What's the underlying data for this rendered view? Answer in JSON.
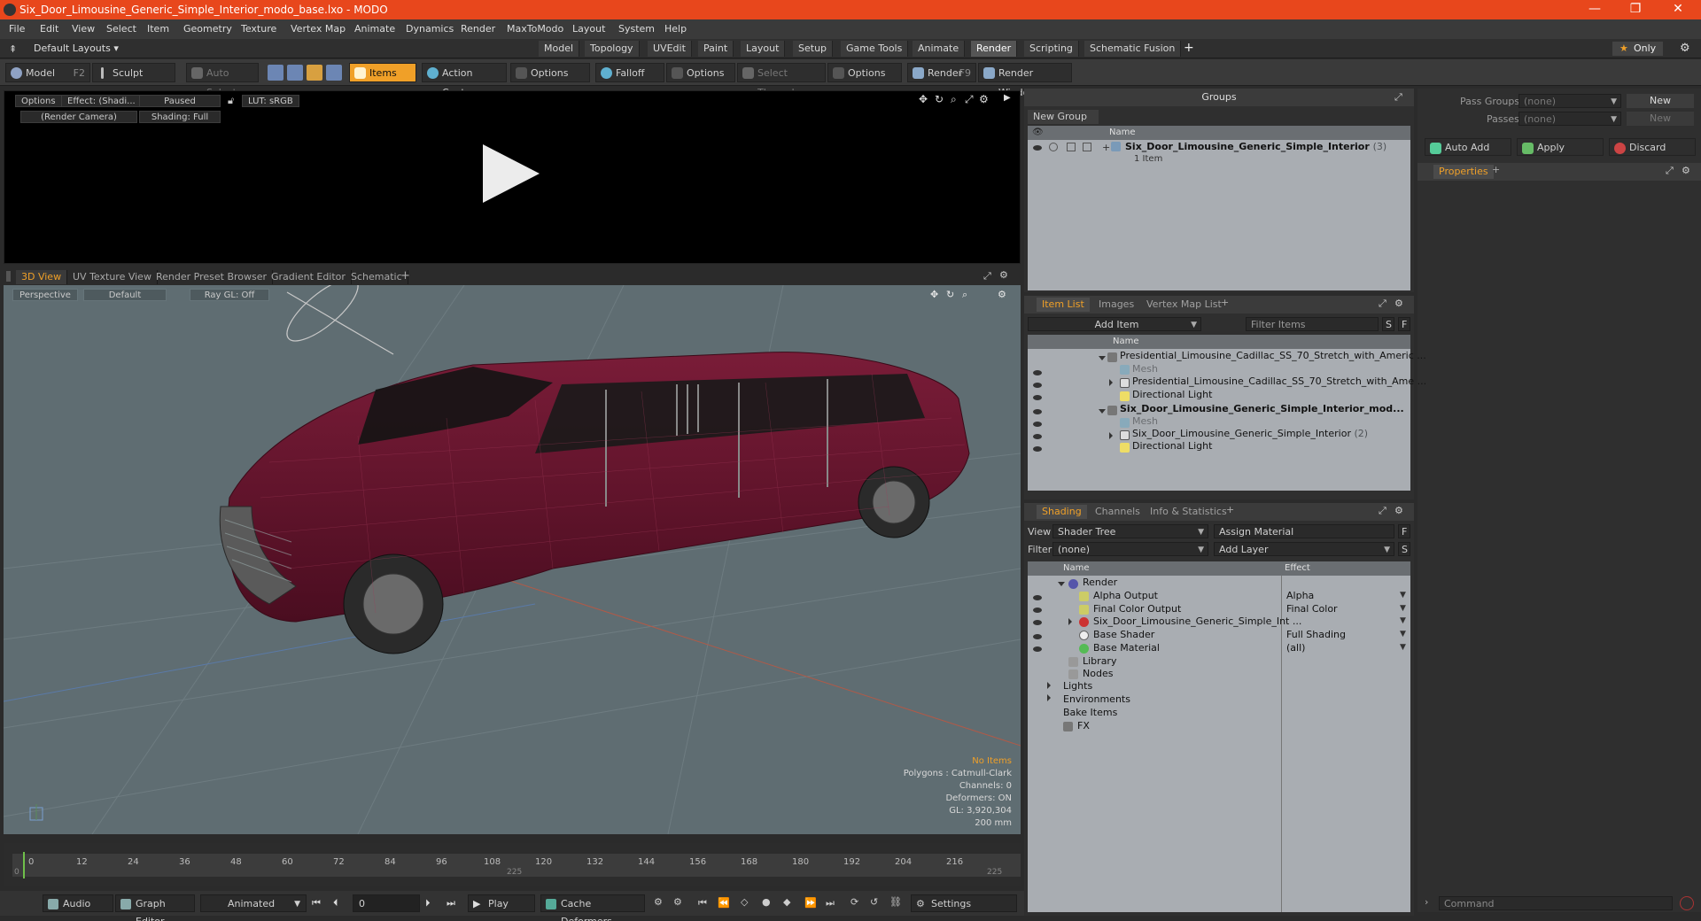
{
  "titlebar": {
    "title": "Six_Door_Limousine_Generic_Simple_Interior_modo_base.lxo - MODO",
    "minimize": "—",
    "restore": "❐",
    "close": "✕"
  },
  "menu": [
    "File",
    "Edit",
    "View",
    "Select",
    "Item",
    "Geometry",
    "Texture",
    "Vertex Map",
    "Animate",
    "Dynamics",
    "Render",
    "MaxToModo",
    "Layout",
    "System",
    "Help"
  ],
  "layoutbar": {
    "layouts": "Default Layouts",
    "tabs": [
      "Model",
      "Topology",
      "UVEdit",
      "Paint",
      "Layout",
      "Setup",
      "Game Tools",
      "Animate",
      "Render",
      "Scripting",
      "Schematic Fusion"
    ],
    "active_tab": "Render",
    "add": "+",
    "only": "Only"
  },
  "toolbar": {
    "model": "Model",
    "model_key": "F2",
    "sculpt": "Sculpt",
    "auto_select": "Auto Select",
    "items": "Items",
    "action_center": "Action Center",
    "options1": "Options",
    "falloff": "Falloff",
    "options2": "Options",
    "select_through": "Select Through",
    "options3": "Options",
    "render": "Render",
    "render_key": "F9",
    "render_window": "Render Window"
  },
  "renderview": {
    "options": "Options",
    "effect": "Effect: (Shadi...",
    "paused": "Paused",
    "lut": "LUT: sRGB",
    "camera": "(Render Camera)",
    "shading": "Shading: Full"
  },
  "viewtabs": [
    "3D View",
    "UV Texture View",
    "Render Preset Browser",
    "Gradient Editor",
    "Schematic"
  ],
  "view3d": {
    "perspective": "Perspective",
    "default": "Default",
    "raygl": "Ray GL: Off",
    "info": {
      "no_items": "No Items",
      "polygons": "Polygons : Catmull-Clark",
      "channels": "Channels: 0",
      "deformers": "Deformers: ON",
      "gl": "GL: 3,920,304",
      "scale": "200 mm"
    }
  },
  "timeline": {
    "ticks": [
      "0",
      "12",
      "24",
      "36",
      "48",
      "60",
      "72",
      "84",
      "96",
      "108",
      "120",
      "132",
      "144",
      "156",
      "168",
      "180",
      "192",
      "204",
      "216"
    ],
    "start": "0",
    "mid": "225",
    "end": "225"
  },
  "bottombar": {
    "audio": "Audio",
    "graph_editor": "Graph Editor",
    "animated": "Animated",
    "frame": "0",
    "play": "Play",
    "cache": "Cache Deformers",
    "settings": "Settings"
  },
  "groups": {
    "title": "Groups",
    "new_group": "New Group",
    "col_name": "Name",
    "item_name": "Six_Door_Limousine_Generic_Simple_Interior",
    "item_count": "(3)",
    "item_sub": "1 Item"
  },
  "passes": {
    "pass_groups_label": "Pass Groups",
    "pass_groups_value": "(none)",
    "new1": "New",
    "passes_label": "Passes",
    "passes_value": "(none)",
    "new2": "New",
    "auto_add": "Auto Add",
    "apply": "Apply",
    "discard": "Discard",
    "properties": "Properties"
  },
  "itemlist": {
    "tabs": [
      "Item List",
      "Images",
      "Vertex Map List"
    ],
    "add_item": "Add Item",
    "filter": "Filter Items",
    "s": "S",
    "f": "F",
    "col_name": "Name",
    "rows": [
      {
        "label": "Presidential_Limousine_Cadillac_SS_70_Stretch_with_Americ ...",
        "count": ""
      },
      {
        "label": "Mesh",
        "count": ""
      },
      {
        "label": "Presidential_Limousine_Cadillac_SS_70_Stretch_with_Ame ...",
        "count": ""
      },
      {
        "label": "Directional Light",
        "count": ""
      },
      {
        "label": "Six_Door_Limousine_Generic_Simple_Interior_mod...",
        "count": ""
      },
      {
        "label": "Mesh",
        "count": ""
      },
      {
        "label": "Six_Door_Limousine_Generic_Simple_Interior",
        "count": "(2)"
      },
      {
        "label": "Directional Light",
        "count": ""
      }
    ]
  },
  "shading": {
    "tabs": [
      "Shading",
      "Channels",
      "Info & Statistics"
    ],
    "view_label": "View",
    "view_value": "Shader Tree",
    "assign": "Assign Material",
    "f": "F",
    "filter_label": "Filter",
    "filter_value": "(none)",
    "add_layer": "Add Layer",
    "s": "S",
    "col_name": "Name",
    "col_effect": "Effect",
    "rows": [
      {
        "name": "Render",
        "effect": ""
      },
      {
        "name": "Alpha Output",
        "effect": "Alpha"
      },
      {
        "name": "Final Color Output",
        "effect": "Final Color"
      },
      {
        "name": "Six_Door_Limousine_Generic_Simple_Int ...",
        "effect": ""
      },
      {
        "name": "Base Shader",
        "effect": "Full Shading"
      },
      {
        "name": "Base Material",
        "effect": "(all)"
      },
      {
        "name": "Library",
        "effect": ""
      },
      {
        "name": "Nodes",
        "effect": ""
      },
      {
        "name": "Lights",
        "effect": ""
      },
      {
        "name": "Environments",
        "effect": ""
      },
      {
        "name": "Bake Items",
        "effect": ""
      },
      {
        "name": "FX",
        "effect": ""
      }
    ]
  },
  "command": {
    "placeholder": "Command"
  },
  "colors": {
    "accent": "#f0a028",
    "titlebar": "#e8471c",
    "car_body": "#6d1530",
    "viewport_bg": "#5f6d72"
  }
}
